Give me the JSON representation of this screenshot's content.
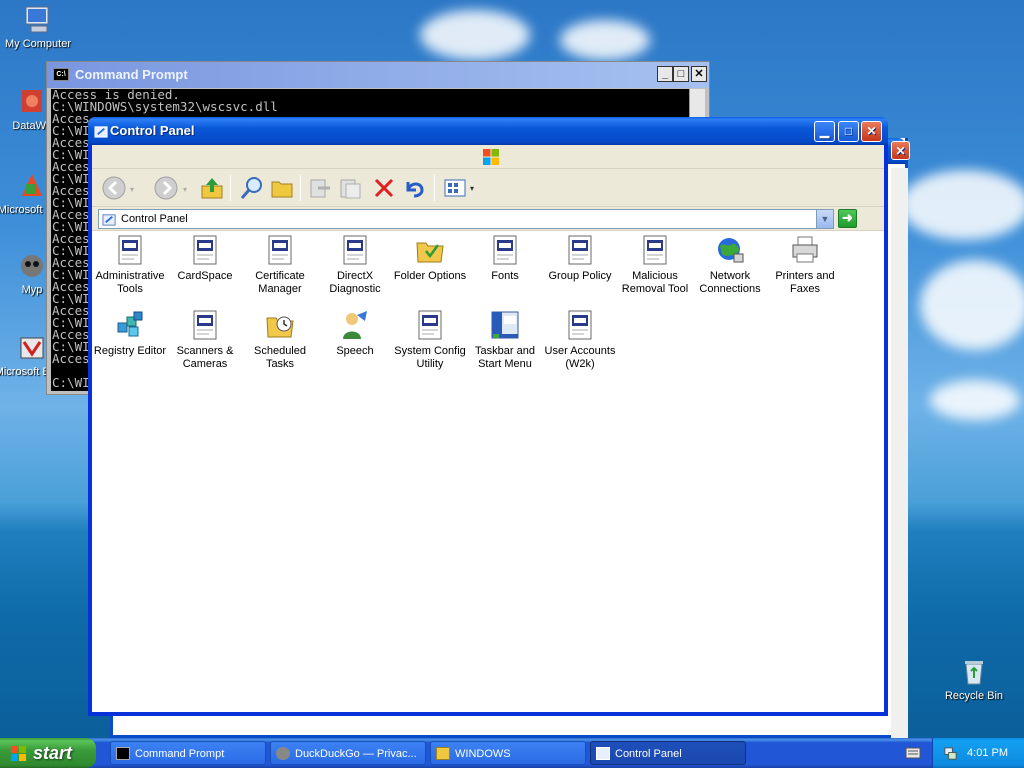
{
  "desktop": {
    "icons": [
      {
        "label": "My Computer"
      },
      {
        "label": "DataWa"
      },
      {
        "label": "Microsoft C++"
      },
      {
        "label": "Myp"
      },
      {
        "label": "Microsoft Basic"
      },
      {
        "label": "Recycle Bin"
      }
    ]
  },
  "command_prompt": {
    "title": "Command Prompt",
    "lines": [
      "Access is denied.",
      "C:\\WINDOWS\\system32\\wscsvc.dll",
      "Acces",
      "C:\\WI",
      "Acces",
      "C:\\WI",
      "Acces",
      "C:\\WI",
      "Acces",
      "C:\\WI",
      "Acces",
      "C:\\WI",
      "Acces",
      "C:\\WI",
      "Acces",
      "C:\\WI",
      "Acces",
      "C:\\WI",
      "Acces",
      "C:\\WI",
      "Acces",
      "C:\\WI",
      "Acces",
      "",
      "C:\\WI"
    ]
  },
  "control_panel": {
    "title": "Control Panel",
    "address": "Control Panel",
    "items": [
      {
        "label": "Administrative Tools",
        "icon": "applet-icon"
      },
      {
        "label": "CardSpace",
        "icon": "applet-icon"
      },
      {
        "label": "Certificate Manager",
        "icon": "applet-icon"
      },
      {
        "label": "DirectX Diagnostic",
        "icon": "applet-icon"
      },
      {
        "label": "Folder Options",
        "icon": "folder-options-icon"
      },
      {
        "label": "Fonts",
        "icon": "applet-icon"
      },
      {
        "label": "Group Policy",
        "icon": "applet-icon"
      },
      {
        "label": "Malicious Removal Tool",
        "icon": "applet-icon"
      },
      {
        "label": "Network Connections",
        "icon": "network-icon"
      },
      {
        "label": "Printers and Faxes",
        "icon": "printer-icon"
      },
      {
        "label": "Registry Editor",
        "icon": "registry-icon"
      },
      {
        "label": "Scanners & Cameras",
        "icon": "applet-icon"
      },
      {
        "label": "Scheduled Tasks",
        "icon": "scheduled-tasks-icon"
      },
      {
        "label": "Speech",
        "icon": "speech-icon"
      },
      {
        "label": "System Config Utility",
        "icon": "applet-icon"
      },
      {
        "label": "Taskbar and Start Menu",
        "icon": "taskbar-icon"
      },
      {
        "label": "User Accounts (W2k)",
        "icon": "applet-icon"
      }
    ]
  },
  "taskbar": {
    "start_label": "start",
    "buttons": [
      {
        "label": "Command Prompt"
      },
      {
        "label": "DuckDuckGo — Privac..."
      },
      {
        "label": "WINDOWS"
      },
      {
        "label": "Control Panel"
      }
    ],
    "clock": "4:01 PM"
  }
}
